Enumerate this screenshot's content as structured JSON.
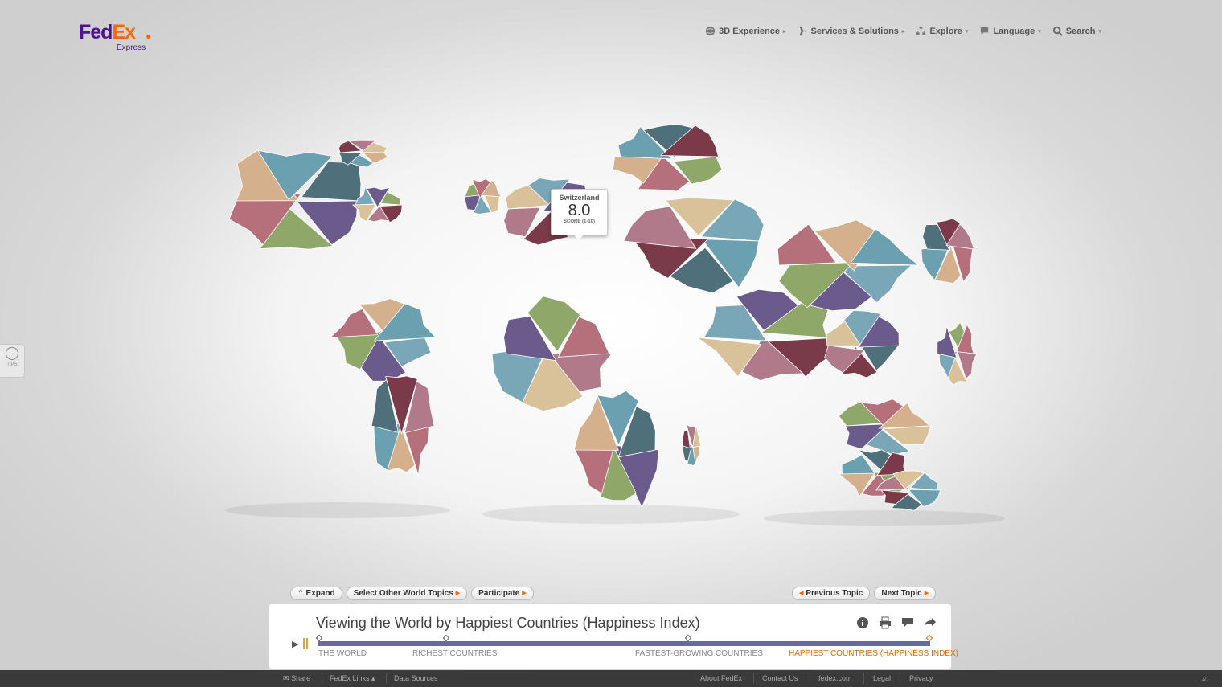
{
  "logo": {
    "brand_left": "Fed",
    "brand_right": "Ex",
    "sub": "Express"
  },
  "topnav": [
    {
      "label": "3D Experience",
      "icon": "globe-icon",
      "caret": "▸"
    },
    {
      "label": "Services & Solutions",
      "icon": "plane-icon",
      "caret": "▸"
    },
    {
      "label": "Explore",
      "icon": "sitemap-icon",
      "caret": "▾"
    },
    {
      "label": "Language",
      "icon": "speech-icon",
      "caret": "▾"
    },
    {
      "label": "Search",
      "icon": "search-icon",
      "caret": "▾"
    }
  ],
  "tips": {
    "label": "TIPS",
    "icon": "lightbulb-icon"
  },
  "callout": {
    "country": "Switzerland",
    "score": "8.0",
    "score_label": "SCORE (1-10)"
  },
  "buttons_left": {
    "expand": "Expand",
    "select": "Select Other World Topics",
    "participate": "Participate"
  },
  "buttons_right": {
    "previous": "Previous Topic",
    "next": "Next Topic"
  },
  "panel": {
    "title": "Viewing the World by Happiest Countries (Happiness Index)",
    "icons": [
      "info-icon",
      "print-icon",
      "comment-icon",
      "share-icon"
    ],
    "timeline": [
      {
        "label": "THE WORLD",
        "active": false
      },
      {
        "label": "RICHEST COUNTRIES",
        "active": false
      },
      {
        "label": "FASTEST-GROWING COUNTRIES",
        "active": false
      },
      {
        "label": "HAPPIEST COUNTRIES (HAPPINESS INDEX)",
        "active": true
      }
    ]
  },
  "footer": {
    "share": "Share",
    "fedex_links": "FedEx Links",
    "data_sources": "Data Sources",
    "about": "About FedEx",
    "contact": "Contact Us",
    "site": "fedex.com",
    "legal": "Legal",
    "privacy": "Privacy"
  },
  "colors": {
    "fedex_purple": "#4d148c",
    "fedex_orange": "#ff6600",
    "track": "#6a6a9a",
    "active_label": "#e06a00",
    "map_palette": [
      "#6b5b8c",
      "#8fa86a",
      "#b5707c",
      "#d4b08c",
      "#6aa0b0",
      "#4f6f7a",
      "#7b3a4a",
      "#b07a8a",
      "#d9c29a",
      "#7aa7b8"
    ]
  }
}
